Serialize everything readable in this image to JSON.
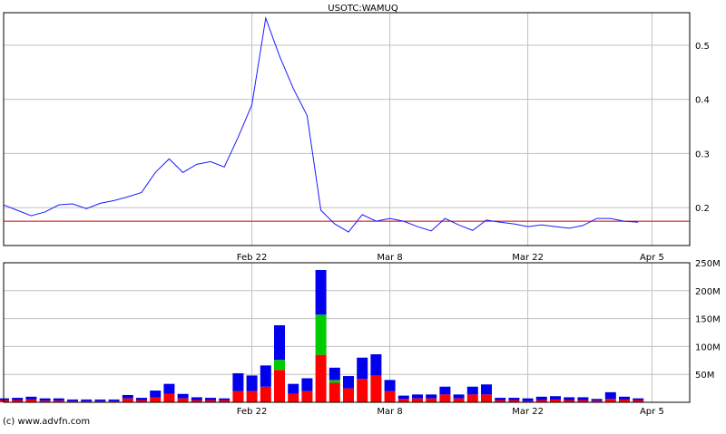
{
  "title": "USOTC:WAMUQ",
  "credit": "(c) www.advfn.com",
  "colors": {
    "price_line": "#1a1aff",
    "reference_line": "#cc0000",
    "grid": "#c0c0c0",
    "frame": "#000000",
    "vol_red": "#ff0000",
    "vol_green": "#00cc00",
    "vol_blue": "#0000ee"
  },
  "chart_data": [
    {
      "type": "line",
      "name": "price",
      "title": "USOTC:WAMUQ",
      "x_ticks": [
        {
          "label": "Feb 22",
          "day": 18
        },
        {
          "label": "Mar 8",
          "day": 28
        },
        {
          "label": "Mar 22",
          "day": 38
        },
        {
          "label": "Apr 5",
          "day": 47
        }
      ],
      "x_range": [
        0,
        50
      ],
      "ylim": [
        0.13,
        0.56
      ],
      "y_ticks": [
        0.2,
        0.3,
        0.4,
        0.5
      ],
      "reference_line": 0.175,
      "grid": true,
      "days": [
        0,
        1,
        2,
        3,
        4,
        5,
        6,
        7,
        8,
        9,
        10,
        11,
        12,
        13,
        14,
        15,
        16,
        17,
        18,
        19,
        20,
        21,
        22,
        23,
        24,
        25,
        26,
        27,
        28,
        29,
        30,
        31,
        32,
        33,
        34,
        35,
        36,
        37,
        38,
        39,
        40,
        41,
        42,
        43,
        44,
        45,
        46,
        47,
        48,
        49
      ],
      "values": [
        0.205,
        0.195,
        0.185,
        0.192,
        0.205,
        0.207,
        0.198,
        0.208,
        0.213,
        0.22,
        0.228,
        0.265,
        0.29,
        0.265,
        0.28,
        0.285,
        0.275,
        0.33,
        0.39,
        0.55,
        0.48,
        0.42,
        0.37,
        0.195,
        0.17,
        0.155,
        0.187,
        0.175,
        0.18,
        0.175,
        0.165,
        0.157,
        0.18,
        0.168,
        0.158,
        0.177,
        0.173,
        0.17,
        0.165,
        0.168,
        0.165,
        0.162,
        0.167,
        0.18,
        0.18,
        0.175,
        0.173
      ]
    },
    {
      "type": "bar",
      "name": "volume",
      "stacked": true,
      "ylim": [
        0,
        250
      ],
      "y_ticks": [
        50,
        100,
        150,
        200,
        250
      ],
      "y_tick_labels": [
        "50M",
        "100M",
        "150M",
        "200M",
        "250M"
      ],
      "grid": true,
      "x_ticks": [
        {
          "label": "Feb 22",
          "day": 18
        },
        {
          "label": "Mar 8",
          "day": 28
        },
        {
          "label": "Mar 22",
          "day": 38
        },
        {
          "label": "Apr 5",
          "day": 47
        }
      ],
      "days": [
        0,
        1,
        2,
        3,
        4,
        5,
        6,
        7,
        8,
        9,
        10,
        11,
        12,
        13,
        14,
        15,
        16,
        17,
        18,
        19,
        20,
        21,
        22,
        23,
        24,
        25,
        26,
        27,
        28,
        29,
        30,
        31,
        32,
        33,
        34,
        35,
        36,
        37,
        38,
        39,
        40,
        41,
        42,
        43,
        44,
        45,
        46
      ],
      "series": [
        {
          "color_key": "vol_red",
          "values": [
            4,
            4,
            5,
            3,
            3,
            2,
            2,
            2,
            2,
            7,
            4,
            9,
            15,
            7,
            4,
            4,
            4,
            20,
            20,
            28,
            58,
            15,
            20,
            85,
            35,
            25,
            42,
            48,
            20,
            6,
            7,
            7,
            14,
            7,
            14,
            14,
            4,
            4,
            2,
            4,
            5,
            4,
            4,
            3,
            6,
            5,
            4,
            3,
            2,
            2
          ]
        },
        {
          "color_key": "vol_green",
          "values": [
            0,
            0,
            0,
            0,
            0,
            0,
            0,
            0,
            0,
            0,
            0,
            0,
            0,
            0,
            0,
            0,
            0,
            0,
            0,
            0,
            18,
            0,
            0,
            72,
            5,
            0,
            0,
            0,
            0,
            0,
            0,
            0,
            0,
            0,
            0,
            0,
            0,
            0,
            0,
            0,
            0,
            0,
            0,
            0,
            0,
            0,
            0,
            0,
            0,
            0
          ]
        },
        {
          "color_key": "vol_blue",
          "values": [
            3,
            4,
            5,
            4,
            4,
            3,
            3,
            3,
            3,
            6,
            4,
            12,
            18,
            8,
            5,
            4,
            3,
            32,
            28,
            38,
            62,
            18,
            23,
            80,
            22,
            22,
            38,
            38,
            20,
            6,
            7,
            7,
            14,
            7,
            14,
            18,
            4,
            4,
            5,
            6,
            6,
            5,
            5,
            3,
            12,
            5,
            3,
            2,
            1,
            1
          ]
        }
      ]
    }
  ]
}
